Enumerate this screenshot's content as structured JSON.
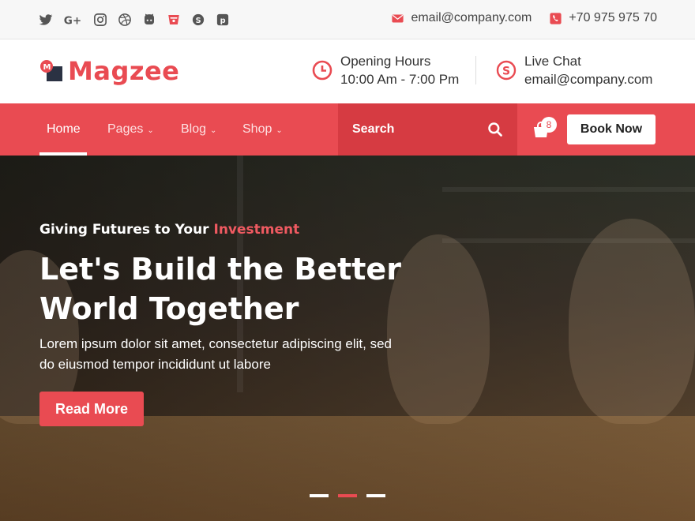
{
  "topbar": {
    "social": [
      {
        "icon": "twitter-icon",
        "glyph": "t"
      },
      {
        "icon": "google-plus-icon",
        "glyph": "G+"
      },
      {
        "icon": "instagram-icon",
        "glyph": "i"
      },
      {
        "icon": "dribbble-icon",
        "glyph": "d"
      },
      {
        "icon": "github-icon",
        "glyph": "g"
      },
      {
        "icon": "bitbucket-icon",
        "glyph": "b"
      },
      {
        "icon": "skype-icon",
        "glyph": "s"
      },
      {
        "icon": "pinterest-icon",
        "glyph": "p"
      }
    ],
    "email": "email@company.com",
    "phone": "+70 975 975 70"
  },
  "header": {
    "logo_text": "Magzee",
    "opening_label": "Opening Hours",
    "opening_hours": "10:00 Am - 7:00 Pm",
    "chat_label": "Live Chat",
    "chat_email": "email@company.com"
  },
  "nav": {
    "items": [
      {
        "label": "Home",
        "active": true
      },
      {
        "label": "Pages",
        "dropdown": true
      },
      {
        "label": "Blog",
        "dropdown": true
      },
      {
        "label": "Shop",
        "dropdown": true
      }
    ],
    "search_label": "Search",
    "cart_count": "8",
    "book_label": "Book Now"
  },
  "hero": {
    "eyebrow_prefix": "Giving Futures to Your",
    "eyebrow_highlight": "Investment",
    "headline": "Let's Build the Better World Together",
    "subtext": "Lorem ipsum dolor sit amet, consectetur adipiscing elit, sed do eiusmod tempor incididunt ut labore",
    "button_label": "Read More",
    "slides": 3,
    "active_slide": 2
  },
  "colors": {
    "accent": "#e94b52",
    "accent_dark": "#d63b42",
    "topbar_bg": "#f7f7f7"
  }
}
